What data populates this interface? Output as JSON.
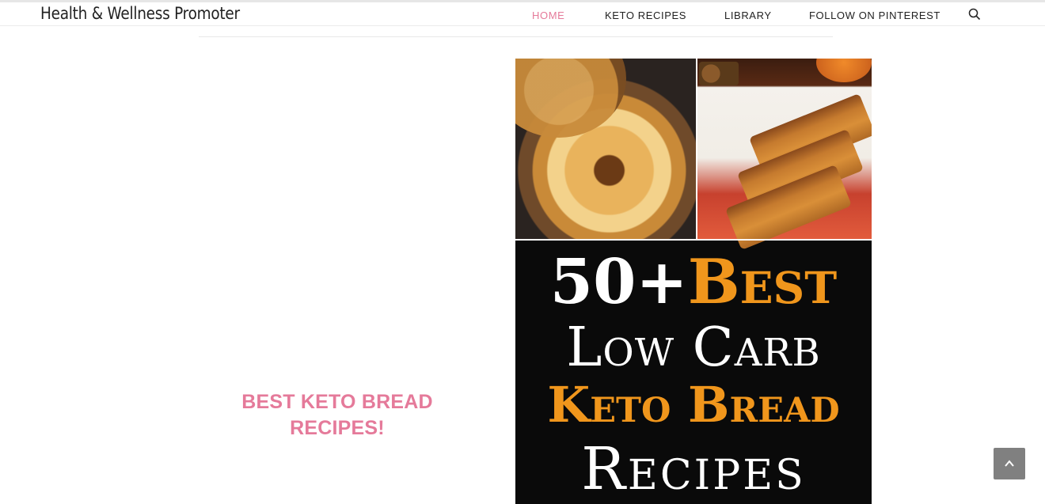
{
  "header": {
    "site_title": "Health & Wellness Promoter",
    "nav": [
      {
        "label": "HOME",
        "active": true
      },
      {
        "label": "KETO RECIPES",
        "active": false
      },
      {
        "label": "LIBRARY",
        "active": false
      },
      {
        "label": "FOLLOW ON PINTEREST",
        "active": false
      }
    ],
    "search_icon": "search-icon"
  },
  "main": {
    "promo_heading_line1": "BEST KETO BREAD",
    "promo_heading_line2": "RECIPES!",
    "pin_image": {
      "line1_white": "50+",
      "line1_orange": "Best",
      "line2": "Low Carb",
      "line3": "Keto Bread",
      "line4": "Recipes"
    }
  },
  "scroll_top": {
    "icon": "chevron-up-icon"
  },
  "colors": {
    "accent_pink": "#e57a9a",
    "image_orange": "#f0961c",
    "scroll_button": "#808080"
  }
}
